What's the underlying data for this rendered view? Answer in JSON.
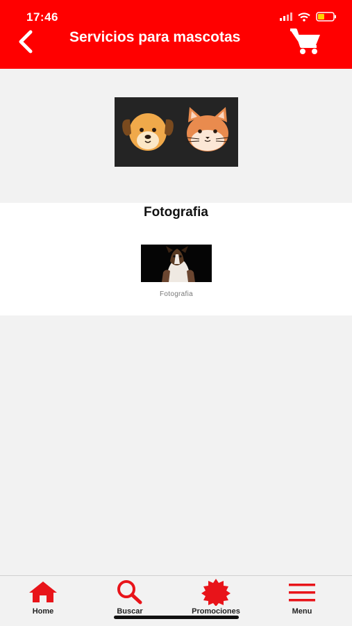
{
  "status_bar": {
    "time": "17:46"
  },
  "header": {
    "title": "Servicios para mascotas"
  },
  "section": {
    "title": "Fotografia",
    "items": [
      {
        "label": "Fotografia"
      }
    ]
  },
  "tabbar": {
    "tabs": [
      {
        "label": "Home",
        "icon": "home-icon"
      },
      {
        "label": "Buscar",
        "icon": "search-icon"
      },
      {
        "label": "Promociones",
        "icon": "badge-icon"
      },
      {
        "label": "Menu",
        "icon": "menu-icon"
      }
    ]
  },
  "colors": {
    "brand": "#ff0000",
    "background": "#f2f2f2"
  }
}
